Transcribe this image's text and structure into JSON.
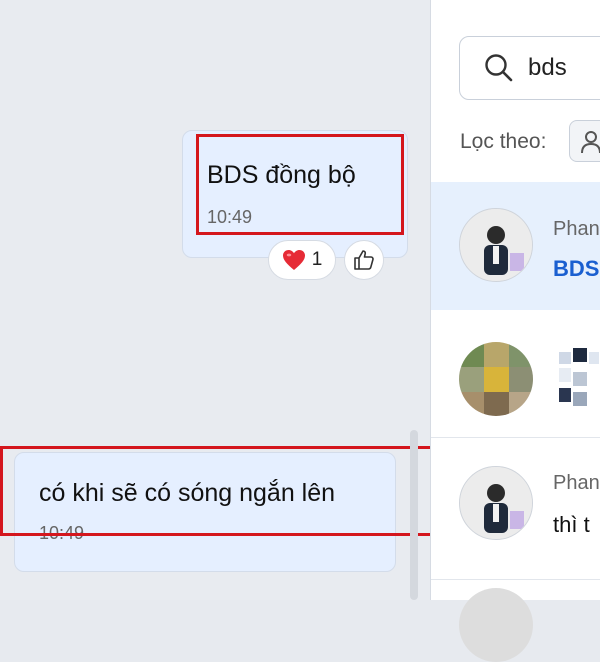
{
  "chat": {
    "messages": [
      {
        "text": "BDS đồng bộ",
        "time": "10:49",
        "reaction": {
          "emoji": "heart",
          "count": "1"
        }
      },
      {
        "text": "có khi sẽ có sóng ngắn lên",
        "time": "10:49"
      }
    ],
    "like_icon": "thumbs-up-icon"
  },
  "sidebar": {
    "search": {
      "value": "bds",
      "icon": "search-icon"
    },
    "filter_label": "Lọc theo:",
    "filter_icon": "person-icon",
    "results": [
      {
        "name": "Phan",
        "snippet": "BDS",
        "active": true
      },
      {
        "name": "",
        "snippet": "",
        "blurred": true
      },
      {
        "name": "Phan",
        "snippet": "thì t"
      },
      {
        "name": "",
        "snippet": ""
      }
    ]
  },
  "colors": {
    "highlight": "#d4161d",
    "bubble": "#e5efff",
    "active_result": "#e6f0fd",
    "link_blue": "#1a5fd0"
  }
}
